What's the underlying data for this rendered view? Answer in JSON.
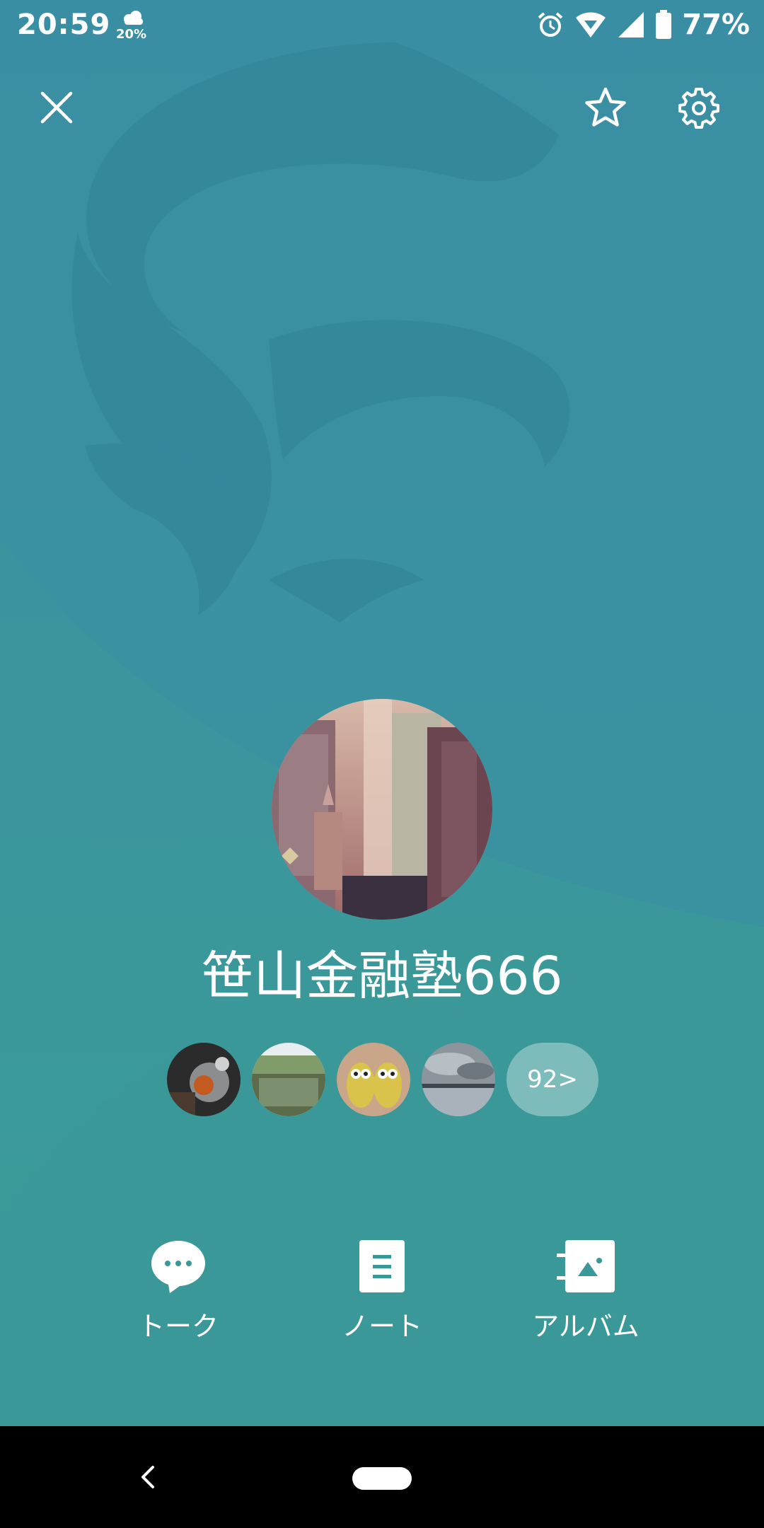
{
  "status_bar": {
    "time": "20:59",
    "weather_percent": "20%",
    "battery_percent": "77%",
    "icons": [
      "weather-icon",
      "alarm-icon",
      "wifi-icon",
      "cell-signal-icon",
      "battery-icon"
    ]
  },
  "header": {
    "close_icon": "close-icon",
    "favorite_icon": "star-icon",
    "settings_icon": "gear-icon"
  },
  "profile": {
    "name": "笹山金融塾666"
  },
  "photos": {
    "thumbnails": [
      "cat-photo",
      "pond-photo",
      "owls-photo",
      "lake-photo"
    ],
    "more_label": "92>"
  },
  "actions": {
    "talk": "トーク",
    "note": "ノート",
    "album": "アルバム"
  },
  "colors": {
    "background": "#3a9898",
    "background_top": "#3a8fa3",
    "logo_shade": "#35859a"
  }
}
